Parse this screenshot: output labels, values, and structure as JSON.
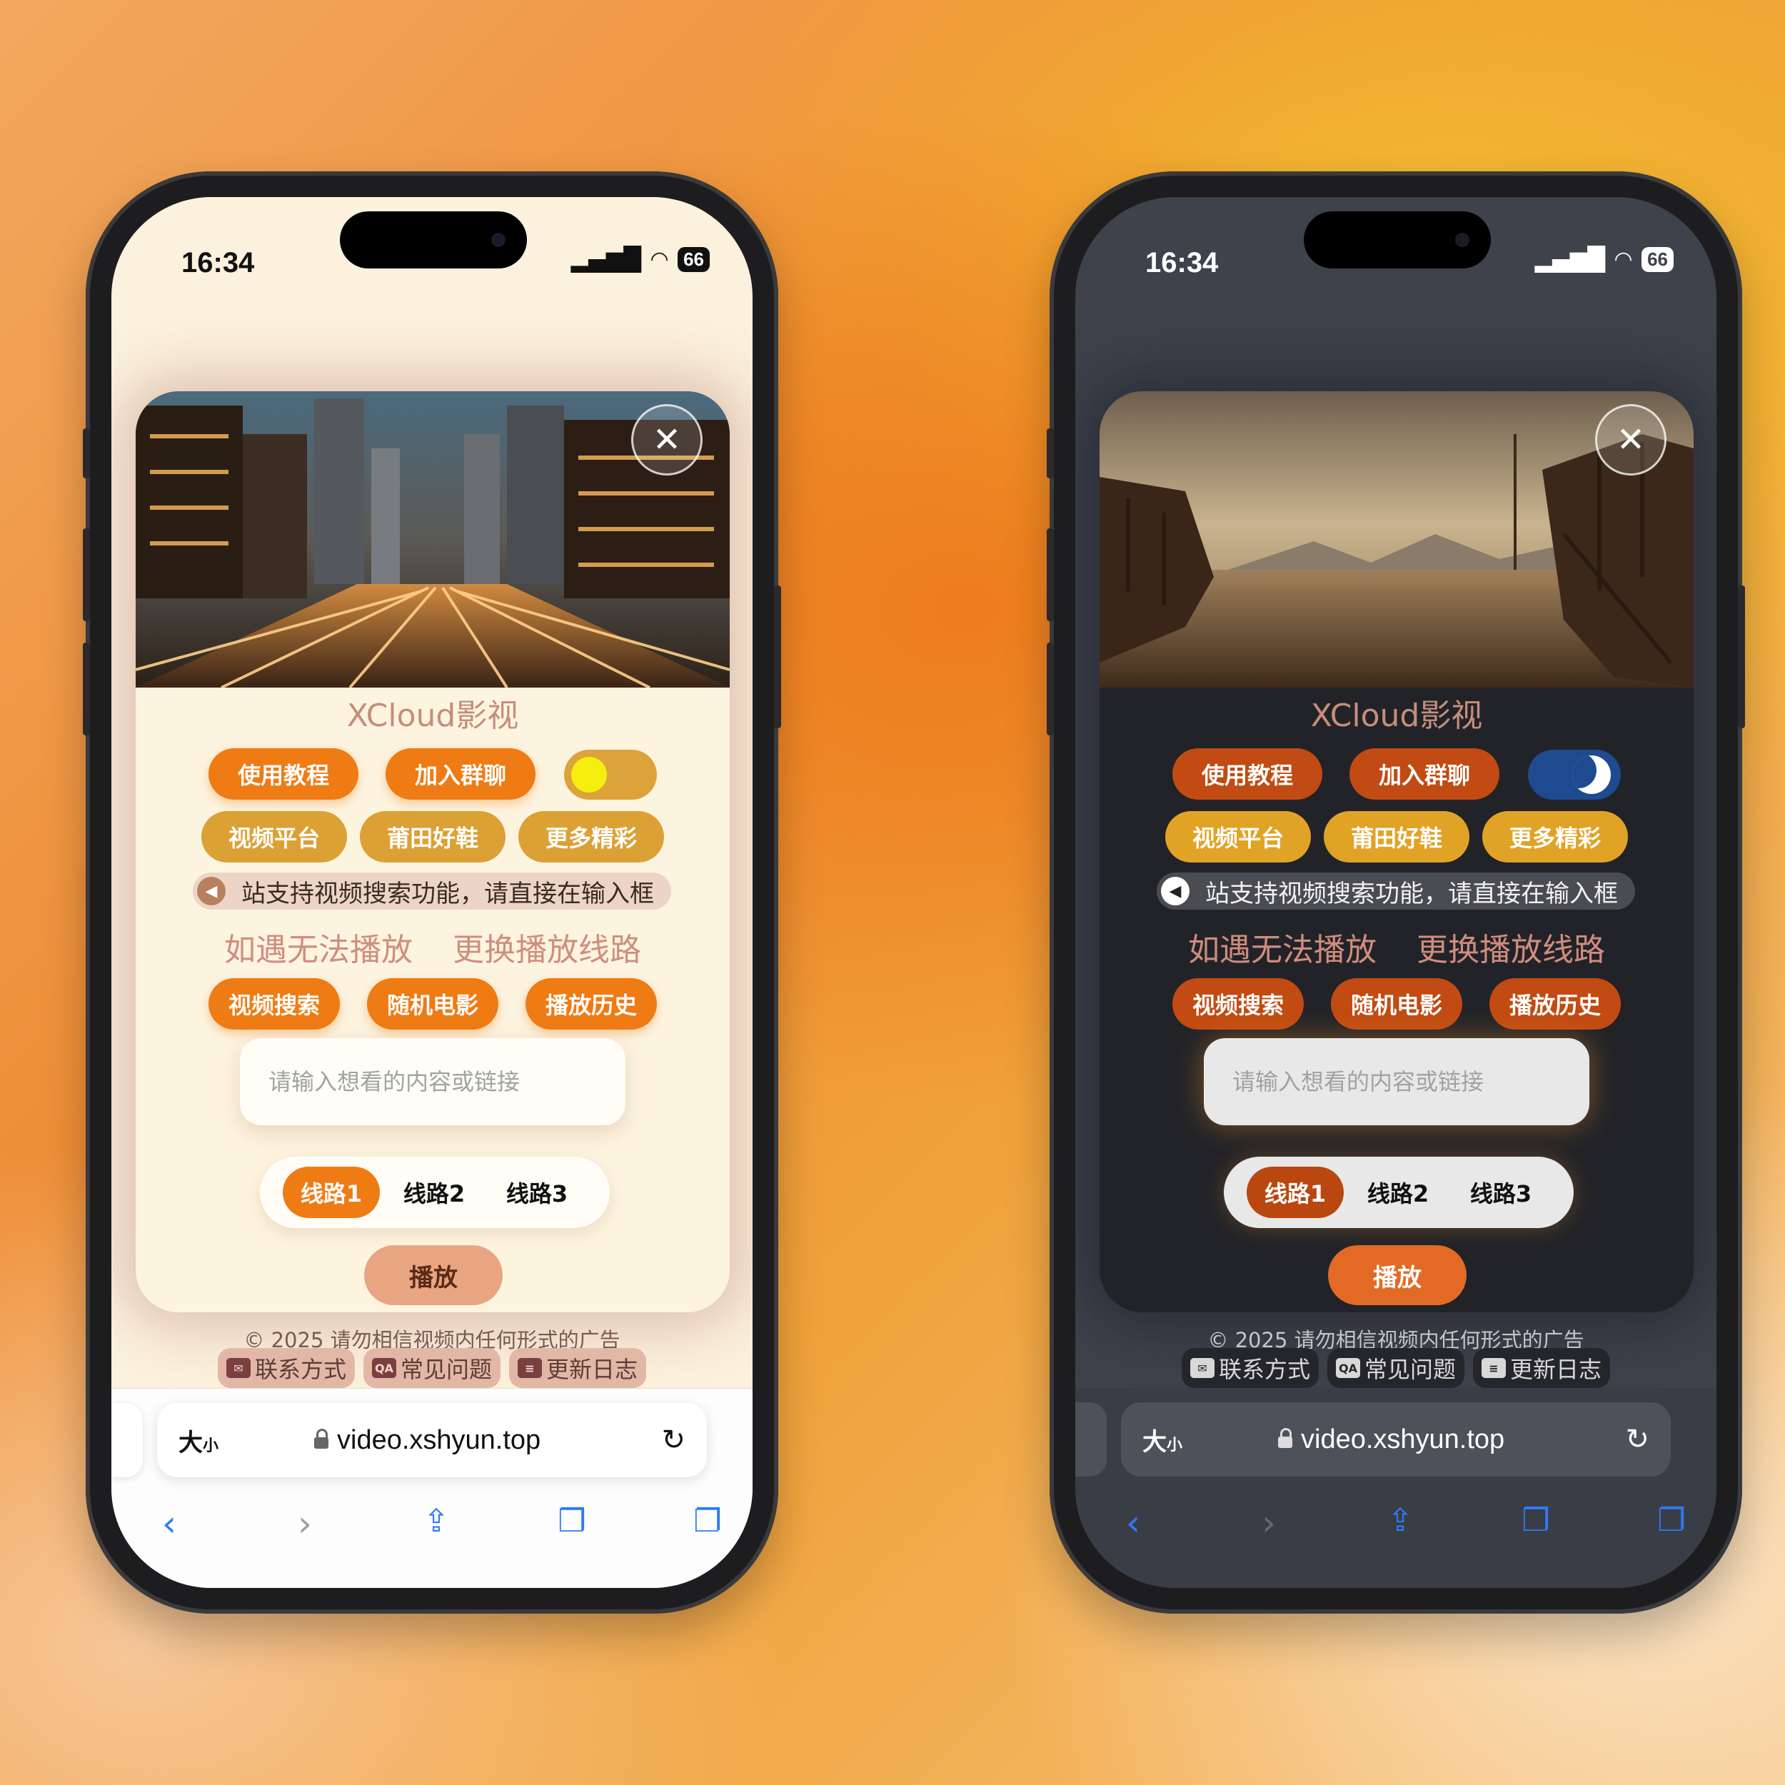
{
  "phones": {
    "left": {
      "theme": "light",
      "status": {
        "time": "16:34",
        "battery": "66"
      },
      "site_title": "XCloud影视",
      "buttons_row1": [
        "使用教程",
        "加入群聊"
      ],
      "buttons_row2": [
        "视频平台",
        "莆田好鞋",
        "更多精彩"
      ],
      "notice": "站支持视频搜索功能，请直接在输入框",
      "help_text": [
        "如遇无法播放",
        "更换播放线路"
      ],
      "buttons_row3": [
        "视频搜索",
        "随机电影",
        "播放历史"
      ],
      "search_placeholder": "请输入想看的内容或链接",
      "routes": [
        "线路1",
        "线路2",
        "线路3"
      ],
      "active_route": "线路1",
      "play_label": "播放",
      "copyright": "© 2025 请勿相信视频内任何形式的广告",
      "footer_links": [
        {
          "icon": "mail-icon",
          "label": "联系方式"
        },
        {
          "icon": "qa-icon",
          "label": "常见问题"
        },
        {
          "icon": "log-icon",
          "label": "更新日志"
        }
      ],
      "safari": {
        "text_size": "大",
        "text_size_small": "小",
        "url": "video.xshyun.top"
      },
      "toggle_state": "sun"
    },
    "right": {
      "theme": "dark",
      "status": {
        "time": "16:34",
        "battery": "66"
      },
      "site_title": "XCloud影视",
      "buttons_row1": [
        "使用教程",
        "加入群聊"
      ],
      "buttons_row2": [
        "视频平台",
        "莆田好鞋",
        "更多精彩"
      ],
      "notice": "站支持视频搜索功能，请直接在输入框",
      "help_text": [
        "如遇无法播放",
        "更换播放线路"
      ],
      "buttons_row3": [
        "视频搜索",
        "随机电影",
        "播放历史"
      ],
      "search_placeholder": "请输入想看的内容或链接",
      "routes": [
        "线路1",
        "线路2",
        "线路3"
      ],
      "active_route": "线路1",
      "play_label": "播放",
      "copyright": "© 2025 请勿相信视频内任何形式的广告",
      "footer_links": [
        {
          "icon": "mail-icon",
          "label": "联系方式"
        },
        {
          "icon": "qa-icon",
          "label": "常见问题"
        },
        {
          "icon": "log-icon",
          "label": "更新日志"
        }
      ],
      "safari": {
        "text_size": "大",
        "text_size_small": "小",
        "url": "video.xshyun.top"
      },
      "toggle_state": "moon"
    }
  },
  "colors": {
    "accent_orange": "#ef7b14",
    "dark_accent": "#c14b12",
    "gold": "#dca135",
    "safari_blue": "#2f7bf6"
  }
}
